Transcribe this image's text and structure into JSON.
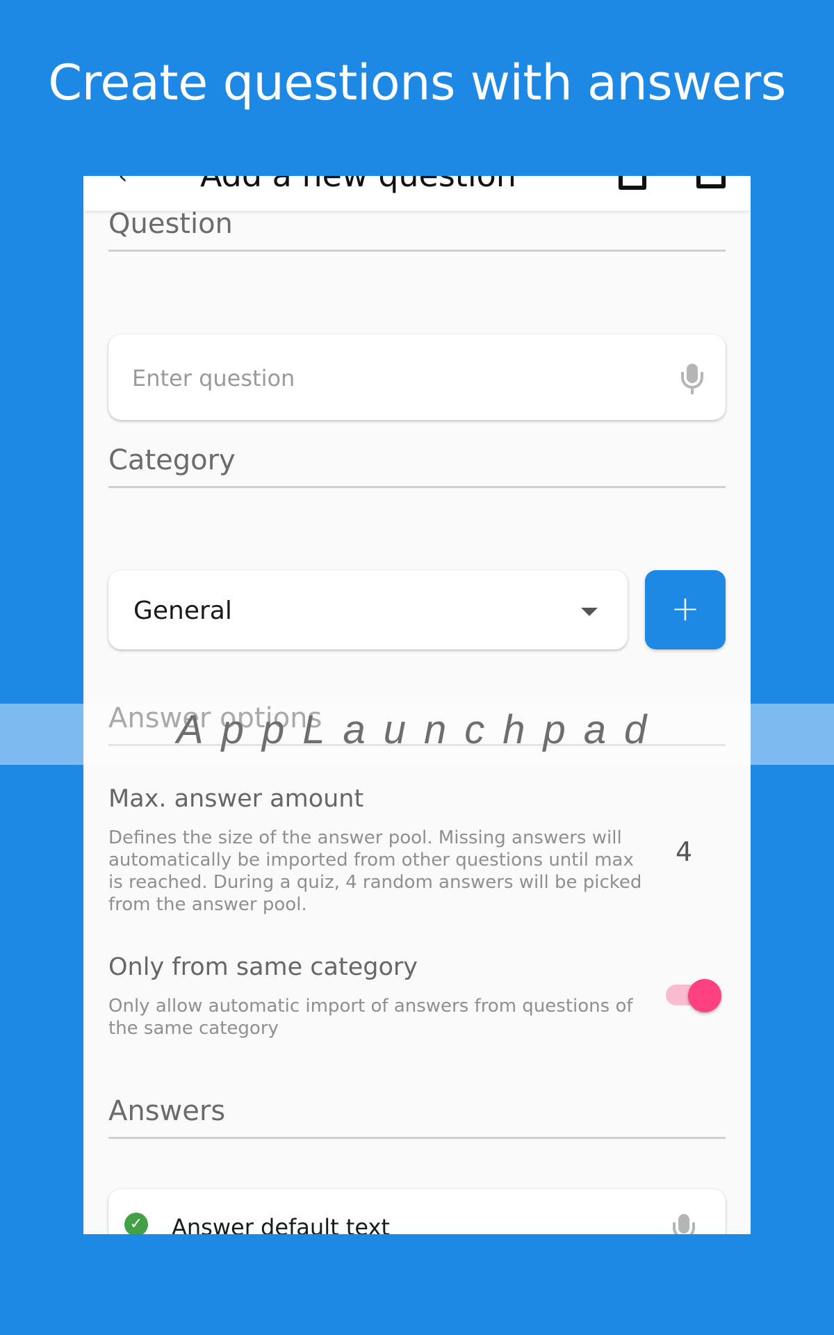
{
  "headline": "Create questions with answers",
  "app_bar": {
    "title": "Add a new question",
    "back_icon": "arrow-back-icon",
    "action_icons": [
      "clipboard-icon",
      "save-icon"
    ]
  },
  "question_section": {
    "label": "Question",
    "input_placeholder": "Enter question",
    "mic_icon": "microphone-icon"
  },
  "category_section": {
    "label": "Category",
    "selected": "General",
    "add_button": "+"
  },
  "answer_options": {
    "label": "Answer options",
    "max_answer": {
      "title": "Max. answer amount",
      "description": "Defines the size of the answer pool. Missing answers will automatically be imported from other questions until max is reached. During a quiz, 4 random answers will be picked from the answer pool.",
      "value": "4"
    },
    "same_category": {
      "title": "Only from same category",
      "description": "Only allow automatic import of answers from questions of the same category",
      "enabled": true
    }
  },
  "answers_section": {
    "label": "Answers",
    "items": [
      {
        "text": "Answer default text",
        "correct": true
      }
    ]
  },
  "watermark": "AppLaunchpad",
  "colors": {
    "background": "#1e88e5",
    "accent": "#ff4081",
    "correct": "#43a047"
  }
}
